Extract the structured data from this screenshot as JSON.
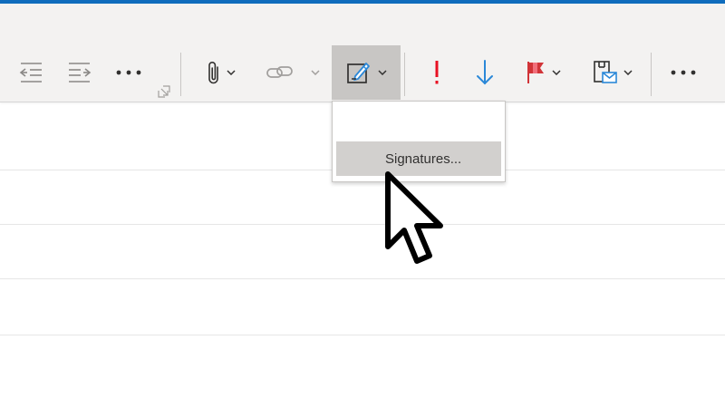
{
  "colors": {
    "accent_blue": "#0f6cbd",
    "ribbon_bg": "#f3f2f1",
    "icon_gray": "#8a8886",
    "icon_dark": "#323130",
    "importance_red": "#e81123",
    "flag_red": "#d13438",
    "down_blue": "#2b88d8",
    "hover_gray": "#c8c6c4"
  },
  "toolbar": {
    "icons": [
      "decrease-indent-icon",
      "increase-indent-icon",
      "more-options-icon",
      "dialog-launcher-icon",
      "attach-file-icon",
      "insert-link-icon",
      "signature-icon",
      "high-importance-icon",
      "low-importance-icon",
      "follow-up-flag-icon",
      "sensitivity-save-icon",
      "more-commands-icon"
    ]
  },
  "signature_menu": {
    "items": [
      {
        "label": "Signatures..."
      }
    ]
  }
}
